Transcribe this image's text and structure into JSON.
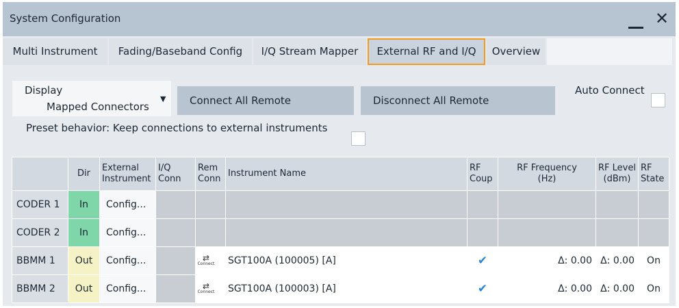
{
  "window": {
    "title": "System Configuration"
  },
  "tabs": [
    {
      "label": "Multi Instrument"
    },
    {
      "label": "Fading/Baseband Config"
    },
    {
      "label": "I/Q Stream Mapper"
    },
    {
      "label": "External RF and I/Q",
      "active": true
    },
    {
      "label": "Overview"
    }
  ],
  "controls": {
    "display_label_line1": "Display",
    "display_label_line2": "Mapped Connectors",
    "connect_all": "Connect All Remote",
    "disconnect_all": "Disconnect All Remote",
    "auto_connect_label": "Auto Connect",
    "auto_connect_checked": false,
    "preset_label": "Preset behavior: Keep connections to external instruments",
    "preset_checked": false
  },
  "table": {
    "headers": {
      "dir": "Dir",
      "ext_line1": "External",
      "ext_line2": "Instrument",
      "iq_line1": "I/Q",
      "iq_line2": "Conn",
      "rem_line1": "Rem",
      "rem_line2": "Conn",
      "name": "Instrument Name",
      "rfcoup_line1": "RF",
      "rfcoup_line2": "Coup",
      "freq_line1": "RF Frequency",
      "freq_line2": "(Hz)",
      "level_line1": "RF Level",
      "level_line2": "(dBm)",
      "state_line1": "RF",
      "state_line2": "State"
    },
    "connect_icon_label": "Connect",
    "rows": [
      {
        "label": "CODER 1",
        "dir": "In",
        "ext": "Config...",
        "name": "",
        "rf_coup": false,
        "freq": "",
        "level": "",
        "state": ""
      },
      {
        "label": "CODER 2",
        "dir": "In",
        "ext": "Config...",
        "name": "",
        "rf_coup": false,
        "freq": "",
        "level": "",
        "state": ""
      },
      {
        "label": "BBMM 1",
        "dir": "Out",
        "ext": "Config...",
        "name": "SGT100A (100005) [A]",
        "rf_coup": true,
        "freq": "Δ: 0.00",
        "level": "Δ: 0.00",
        "state": "On"
      },
      {
        "label": "BBMM 2",
        "dir": "Out",
        "ext": "Config...",
        "name": "SGT100A (100003) [A]",
        "rf_coup": true,
        "freq": "Δ: 0.00",
        "level": "Δ: 0.00",
        "state": "On"
      }
    ]
  }
}
